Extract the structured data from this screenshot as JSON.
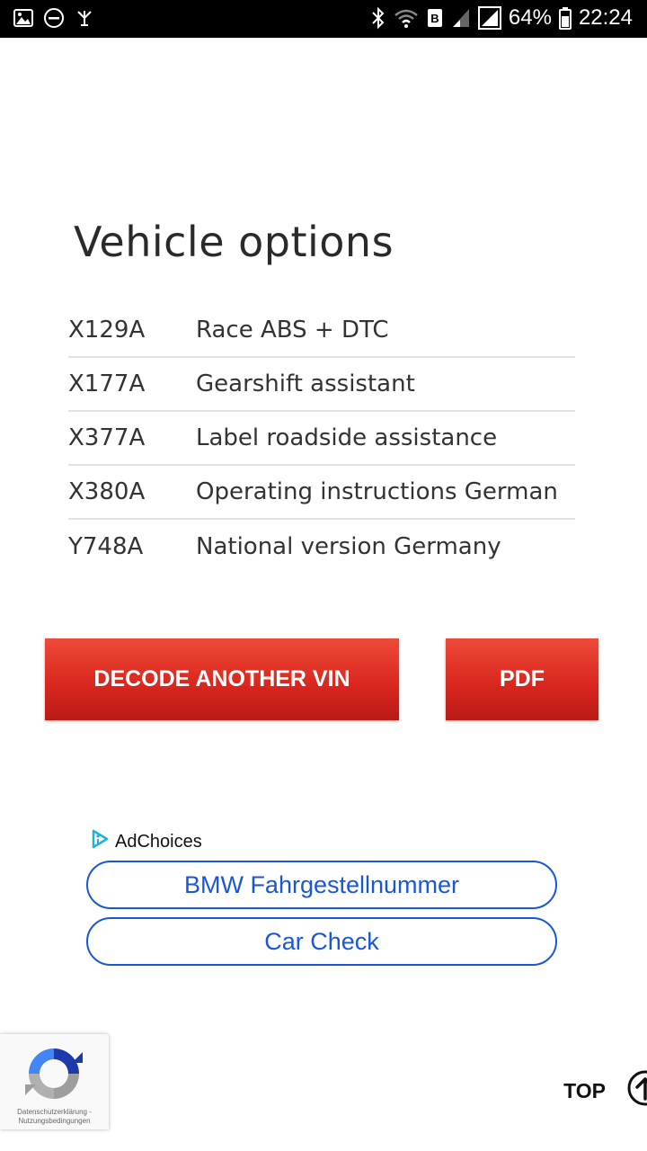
{
  "status_bar": {
    "battery": "64%",
    "time": "22:24",
    "icons_left": [
      "image-icon",
      "do-not-disturb-icon",
      "signal-booster-icon"
    ],
    "icons_right": [
      "bluetooth-icon",
      "wifi-icon",
      "data-icon",
      "signal-icon",
      "signal-icon",
      "battery-icon"
    ]
  },
  "page": {
    "title": "Vehicle options"
  },
  "options": [
    {
      "code": "X129A",
      "description": "Race ABS + DTC"
    },
    {
      "code": "X177A",
      "description": "Gearshift assistant"
    },
    {
      "code": "X377A",
      "description": "Label roadside assistance"
    },
    {
      "code": "X380A",
      "description": "Operating instructions German"
    },
    {
      "code": "Y748A",
      "description": "National version Germany"
    }
  ],
  "actions": {
    "decode_label": "DECODE ANOTHER VIN",
    "pdf_label": "PDF"
  },
  "ads": {
    "adchoices_label": "AdChoices",
    "links": [
      "BMW Fahrgestellnummer",
      "Car Check"
    ]
  },
  "recaptcha": {
    "line1": "Datenschutzerklärung -",
    "line2": "Nutzungsbedingungen"
  },
  "scroll_top": {
    "label": "TOP"
  },
  "colors": {
    "accent_red": "#d8251d",
    "link_blue": "#1a57d8",
    "divider": "#dde3e6"
  }
}
